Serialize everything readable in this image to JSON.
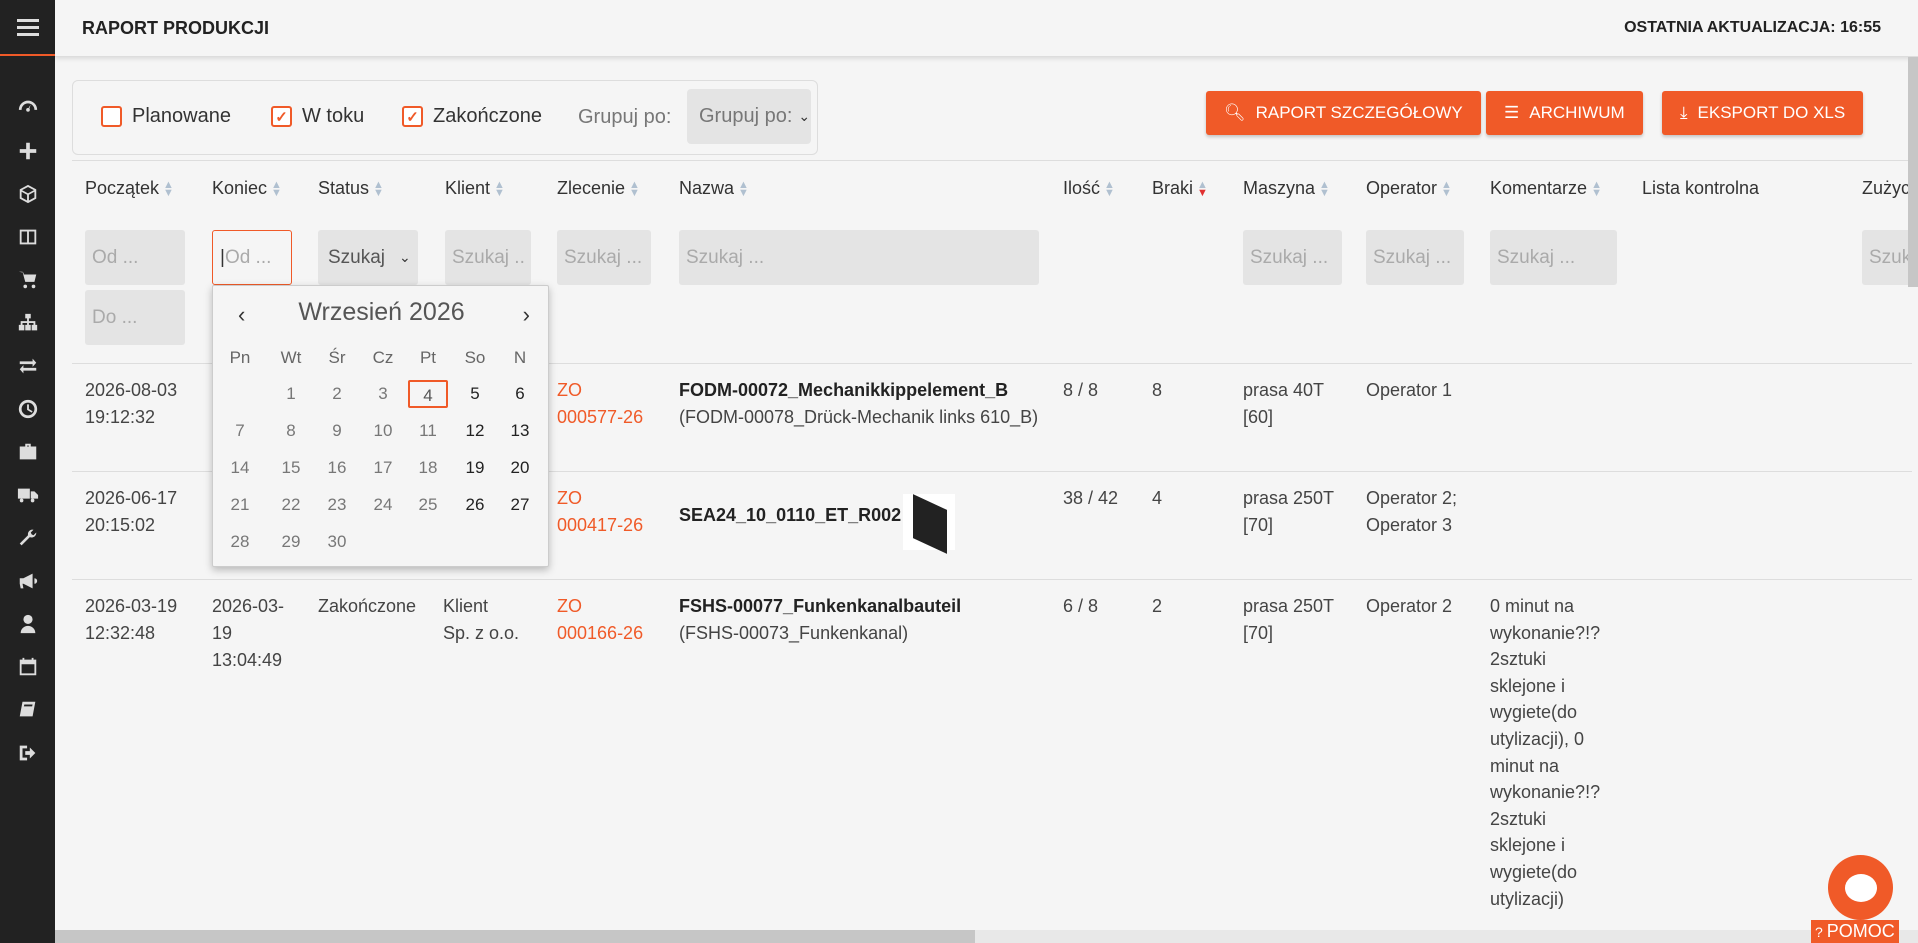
{
  "topbar": {
    "title": "RAPORT PRODUKCJI",
    "last_update": "OSTATNIA AKTUALIZACJA: 16:55"
  },
  "sidebar": {
    "items": [
      "dashboard-icon",
      "plus-icon",
      "cube-icon",
      "columns-icon",
      "cart-icon",
      "sitemap-icon",
      "exchange-icon",
      "clock-icon",
      "briefcase-icon",
      "truck-icon",
      "wrench-icon",
      "bullhorn-icon",
      "user-icon",
      "calendar-icon",
      "book-icon",
      "sign-out-icon"
    ]
  },
  "filters": {
    "planned_label": "Planowane",
    "planned_checked": false,
    "in_progress_label": "W toku",
    "in_progress_checked": true,
    "finished_label": "Zakończone",
    "finished_checked": true,
    "groupby_label": "Grupuj po:",
    "groupby_value": "Grupuj po:"
  },
  "buttons": {
    "detailed_report": "RAPORT SZCZEGÓŁOWY",
    "archive": "ARCHIWUM",
    "export": "EKSPORT DO XLS"
  },
  "columns": {
    "start": "Początek",
    "end": "Koniec",
    "status": "Status",
    "client": "Klient",
    "order": "Zlecenie",
    "name": "Nazwa",
    "qty": "Ilość",
    "defects": "Braki",
    "machine": "Maszyna",
    "operator": "Operator",
    "comments": "Komentarze",
    "checklist": "Lista kontrolna",
    "used": "Zużyc"
  },
  "search": {
    "from": "Od ...",
    "to": "Do ...",
    "search": "Szukaj ...",
    "search_short": "Szukaj ..",
    "status_select": "Szukaj",
    "used_partial": "Szuk"
  },
  "datepicker": {
    "month": "Wrzesień 2026",
    "weekdays": [
      "Pn",
      "Wt",
      "Śr",
      "Cz",
      "Pt",
      "So",
      "N"
    ],
    "today": "4",
    "weeks": [
      [
        "",
        "1",
        "2",
        "3",
        "4",
        "5",
        "6"
      ],
      [
        "7",
        "8",
        "9",
        "10",
        "11",
        "12",
        "13"
      ],
      [
        "14",
        "15",
        "16",
        "17",
        "18",
        "19",
        "20"
      ],
      [
        "21",
        "22",
        "23",
        "24",
        "25",
        "26",
        "27"
      ],
      [
        "28",
        "29",
        "30",
        "",
        "",
        "",
        ""
      ]
    ]
  },
  "rows": [
    {
      "start_date": "2026-08-03",
      "start_time": "19:12:32",
      "order_a": "ZO",
      "order_b": "000577-26",
      "name": "FODM-00072_Mechanikkippelement_B",
      "subname": "(FODM-00078_Drück-Mechanik links 610_B)",
      "qty": "8 / 8",
      "defects": "8",
      "machine_a": "prasa 40T",
      "machine_b": "[60]",
      "operator": "Operator 1"
    },
    {
      "start_date": "2026-06-17",
      "start_time": "20:15:02",
      "order_a": "ZO",
      "order_b": "000417-26",
      "name": "SEA24_10_0110_ET_R002",
      "qty": "38 / 42",
      "defects": "4",
      "machine_a": "prasa 250T",
      "machine_b": "[70]",
      "operator_a": "Operator 2;",
      "operator_b": "Operator 3"
    },
    {
      "start_date": "2026-03-19",
      "start_time": "12:32:48",
      "end_a": "2026-03-",
      "end_b": "19",
      "end_c": "13:04:49",
      "status": "Zakończone",
      "client_a": "Klient",
      "client_b": "Sp. z o.o.",
      "order_a": "ZO",
      "order_b": "000166-26",
      "name": "FSHS-00077_Funkenkanalbauteil",
      "subname": "(FSHS-00073_Funkenkanal)",
      "qty": "6 / 8",
      "defects": "2",
      "machine_a": "prasa 250T",
      "machine_b": "[70]",
      "operator": "Operator 2",
      "comment_lines": [
        "0 minut na",
        "wykonanie?!?",
        "2sztuki",
        "sklejone i",
        "wygiete(do",
        "utylizacji), 0",
        "minut na",
        "wykonanie?!?",
        "2sztuki",
        "sklejone i",
        "wygiete(do",
        "utylizacji)"
      ]
    }
  ],
  "help": "POMOC",
  "colors": {
    "accent": "#f05a28",
    "sidebar": "#222222"
  }
}
